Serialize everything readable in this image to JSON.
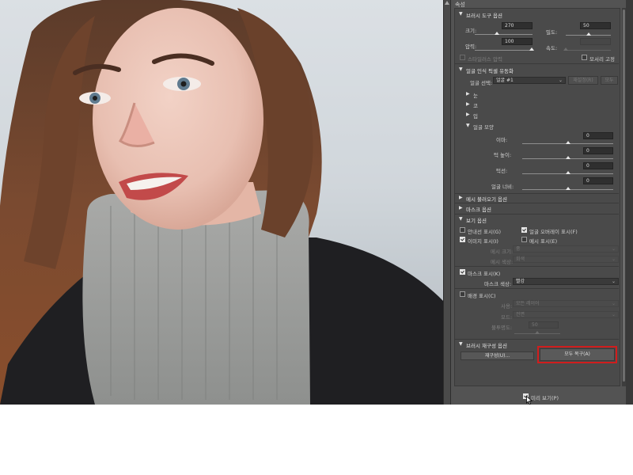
{
  "panel": {
    "title": "속성"
  },
  "brush": {
    "header": "브러시 도구 옵션",
    "size_label": "크기:",
    "size_value": "270",
    "density_label": "밀도:",
    "density_value": "50",
    "pressure_label": "압력:",
    "pressure_value": "100",
    "rate_label": "속도:",
    "stylus_label": "스타일러스 압력",
    "pin_edges_label": "모서리 고정"
  },
  "face_aware": {
    "header": "얼굴 인식 픽셀 유동화",
    "select_label": "얼굴 선택:",
    "select_value": "얼굴 #1",
    "reset_button": "재설정(R)",
    "all_button": "모두",
    "eyes": "눈",
    "nose": "코",
    "mouth": "입",
    "face_shape": "얼굴 모양",
    "forehead_label": "이마:",
    "forehead_value": "0",
    "chin_height_label": "턱 높이:",
    "chin_height_value": "0",
    "jawline_label": "턱선:",
    "jawline_value": "0",
    "face_width_label": "얼굴 너비:",
    "face_width_value": "0"
  },
  "sections": {
    "mesh_load": "메시 불러오기 옵션",
    "mask": "마스크 옵션",
    "view": "보기 옵션"
  },
  "view": {
    "guides_label": "안내선 표시(G)",
    "face_overlay_label": "얼굴 오버레이 표시(F)",
    "show_image_label": "이미지 표시(I)",
    "show_mesh_label": "메시 표시(E)",
    "mesh_size_label": "메시 크기:",
    "mesh_size_value": "중",
    "mesh_color_label": "메시 색상:",
    "mesh_color_value": "회색",
    "show_mask_label": "마스크 표시(K)",
    "mask_color_label": "마스크 색상:",
    "mask_color_value": "빨강",
    "show_backdrop_label": "배경 표시(C)",
    "use_label": "사용:",
    "use_value": "모든 레이어",
    "mode_label": "모드:",
    "mode_value": "전면",
    "opacity_label": "불투명도:",
    "opacity_value": "50"
  },
  "reconstruct": {
    "header": "브러시 재구성 옵션",
    "reconstruct_button": "재구성(U)...",
    "restore_all_button": "모두 복구(A)"
  },
  "footer": {
    "preview_label": "미리 보기(P)"
  },
  "colors": {
    "panel_bg": "#535353",
    "highlight": "#d01d1d"
  }
}
